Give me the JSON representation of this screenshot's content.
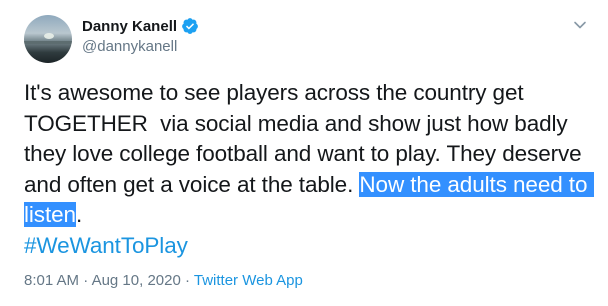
{
  "author": {
    "display_name": "Danny Kanell",
    "handle": "@dannykanell",
    "verified": true
  },
  "tweet": {
    "text_before_highlight": "It's awesome to see players across the country get TOGETHER  via social media and show just how badly they love college football and want to play. They deserve and often get a voice at the table. ",
    "highlighted_text": "Now the adults need to listen",
    "text_after_highlight": ".",
    "hashtag": "#WeWantToPlay"
  },
  "meta": {
    "time": "8:01 AM",
    "separator1": " · ",
    "date": "Aug 10, 2020",
    "separator2": " · ",
    "source": "Twitter Web App"
  },
  "icons": {
    "avatar": "avatar-image",
    "verified": "verified-badge-icon",
    "menu": "chevron-down-icon"
  },
  "colors": {
    "link": "#1b95e0",
    "selection": "#3390ff",
    "text": "#14171a",
    "secondary": "#657786"
  }
}
